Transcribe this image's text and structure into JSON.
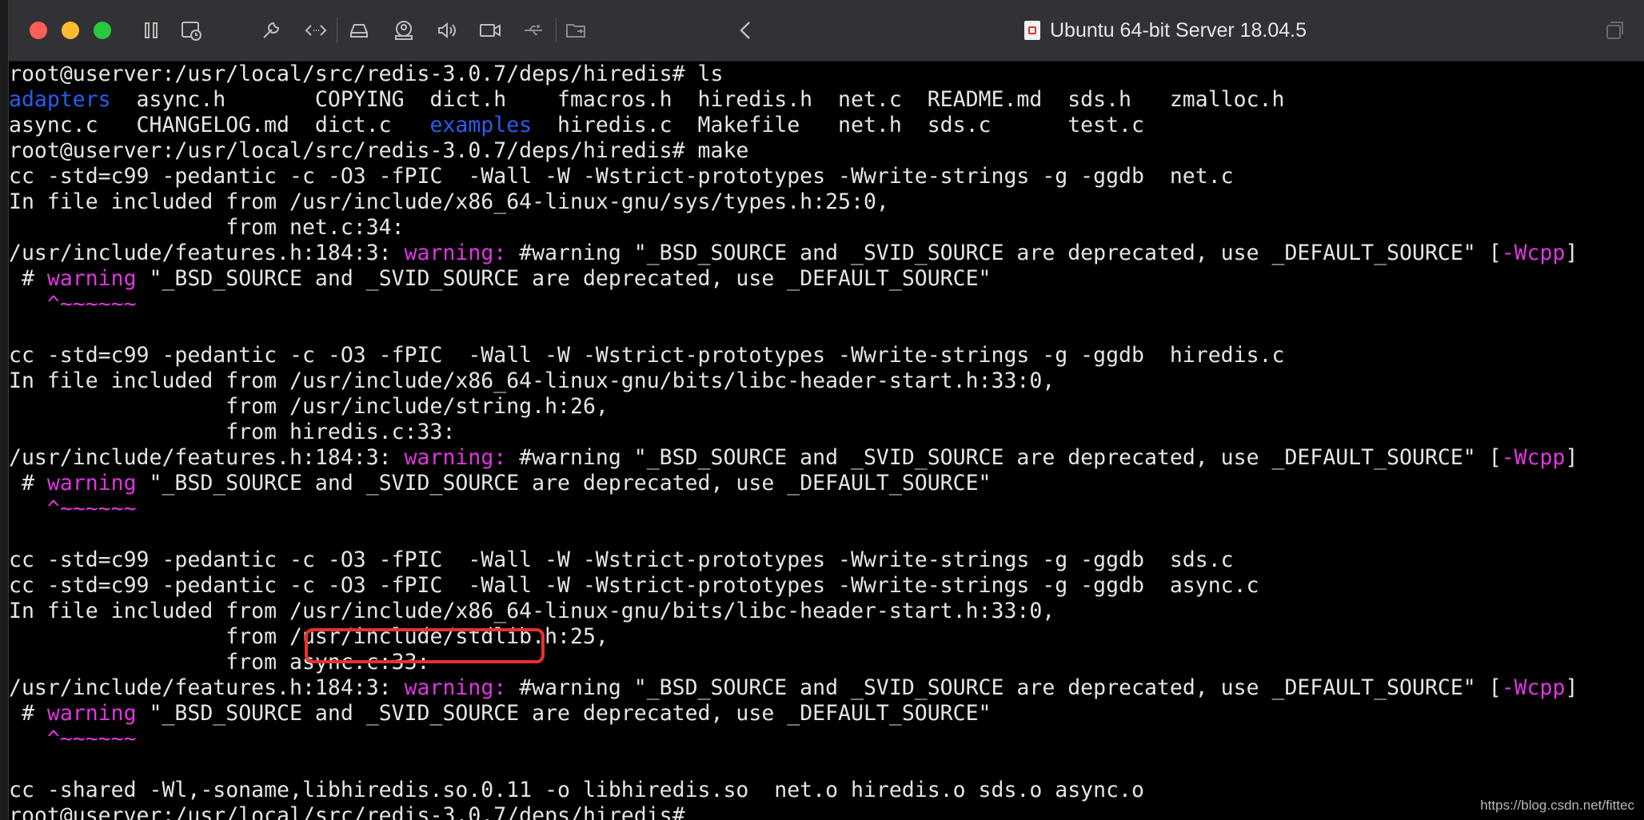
{
  "window": {
    "title": "Ubuntu 64-bit Server 18.04.5"
  },
  "toolbar": {
    "icons": [
      "pause-icon",
      "snapshot-icon",
      "wrench-icon",
      "code-arrows-icon",
      "hard-drive-icon",
      "user-account-icon",
      "sound-icon",
      "camera-icon",
      "usb-icon",
      "shared-folder-icon",
      "back-chevron-icon",
      "fullscreen-icon"
    ]
  },
  "terminal": {
    "lines": [
      [
        {
          "t": "root@userver:/usr/local/src/redis-3.0.7/deps/hiredis# ls"
        }
      ],
      [
        {
          "t": "adapters",
          "c": "blue"
        },
        {
          "t": "  async.h       COPYING  dict.h    fmacros.h  hiredis.h  net.c  README.md  sds.h   zmalloc.h"
        }
      ],
      [
        {
          "t": "async.c   CHANGELOG.md  dict.c   "
        },
        {
          "t": "examples",
          "c": "blue"
        },
        {
          "t": "  hiredis.c  Makefile   net.h  sds.c      test.c"
        }
      ],
      [
        {
          "t": "root@userver:/usr/local/src/redis-3.0.7/deps/hiredis# make"
        }
      ],
      [
        {
          "t": "cc -std=c99 -pedantic -c -O3 -fPIC  -Wall -W -Wstrict-prototypes -Wwrite-strings -g -ggdb  net.c"
        }
      ],
      [
        {
          "t": "In file included from /usr/include/x86_64-linux-gnu/sys/types.h:25:0,"
        }
      ],
      [
        {
          "t": "                 from net.c:34:"
        }
      ],
      [
        {
          "t": "/usr/include/features.h:184:3: "
        },
        {
          "t": "warning:",
          "c": "mag"
        },
        {
          "t": " #warning \"_BSD_SOURCE and _SVID_SOURCE are deprecated, use _DEFAULT_SOURCE\" ["
        },
        {
          "t": "-Wcpp",
          "c": "mag"
        },
        {
          "t": "]"
        }
      ],
      [
        {
          "t": " # "
        },
        {
          "t": "warning",
          "c": "mag"
        },
        {
          "t": " \"_BSD_SOURCE and _SVID_SOURCE are deprecated, use _DEFAULT_SOURCE\""
        }
      ],
      [
        {
          "t": "   ^~~~~~~",
          "c": "mag"
        }
      ],
      [
        {
          "t": "cc -std=c99 -pedantic -c -O3 -fPIC  -Wall -W -Wstrict-prototypes -Wwrite-strings -g -ggdb  hiredis.c"
        }
      ],
      [
        {
          "t": "In file included from /usr/include/x86_64-linux-gnu/bits/libc-header-start.h:33:0,"
        }
      ],
      [
        {
          "t": "                 from /usr/include/string.h:26,"
        }
      ],
      [
        {
          "t": "                 from hiredis.c:33:"
        }
      ],
      [
        {
          "t": "/usr/include/features.h:184:3: "
        },
        {
          "t": "warning:",
          "c": "mag"
        },
        {
          "t": " #warning \"_BSD_SOURCE and _SVID_SOURCE are deprecated, use _DEFAULT_SOURCE\" ["
        },
        {
          "t": "-Wcpp",
          "c": "mag"
        },
        {
          "t": "]"
        }
      ],
      [
        {
          "t": " # "
        },
        {
          "t": "warning",
          "c": "mag"
        },
        {
          "t": " \"_BSD_SOURCE and _SVID_SOURCE are deprecated, use _DEFAULT_SOURCE\""
        }
      ],
      [
        {
          "t": "   ^~~~~~~",
          "c": "mag"
        }
      ],
      [
        {
          "t": "cc -std=c99 -pedantic -c -O3 -fPIC  -Wall -W -Wstrict-prototypes -Wwrite-strings -g -ggdb  sds.c"
        }
      ],
      [
        {
          "t": "cc -std=c99 -pedantic -c -O3 -fPIC  -Wall -W -Wstrict-prototypes -Wwrite-strings -g -ggdb  async.c"
        }
      ],
      [
        {
          "t": "In file included from /usr/include/x86_64-linux-gnu/bits/libc-header-start.h:33:0,"
        }
      ],
      [
        {
          "t": "                 from /usr/include/stdlib.h:25,"
        }
      ],
      [
        {
          "t": "                 from async.c:33:"
        }
      ],
      [
        {
          "t": "/usr/include/features.h:184:3: "
        },
        {
          "t": "warning:",
          "c": "mag"
        },
        {
          "t": " #warning \"_BSD_SOURCE and _SVID_SOURCE are deprecated, use _DEFAULT_SOURCE\" ["
        },
        {
          "t": "-Wcpp",
          "c": "mag"
        },
        {
          "t": "]"
        }
      ],
      [
        {
          "t": " # "
        },
        {
          "t": "warning",
          "c": "mag"
        },
        {
          "t": " \"_BSD_SOURCE and _SVID_SOURCE are deprecated, use _DEFAULT_SOURCE\""
        }
      ],
      [
        {
          "t": "   ^~~~~~~",
          "c": "mag"
        }
      ],
      [
        {
          "t": "cc -shared -Wl,-soname,libhiredis.so.0.11 -o libhiredis.so  net.o hiredis.o sds.o async.o"
        }
      ],
      [
        {
          "t": "root@userver:/usr/local/src/redis-3.0.7/deps/hiredis#"
        }
      ]
    ]
  },
  "watermark": "https://blog.csdn.net/fittec",
  "colors": {
    "blue": "#2a5cf0",
    "magenta": "#e035e0",
    "highlight": "#e8322a"
  }
}
